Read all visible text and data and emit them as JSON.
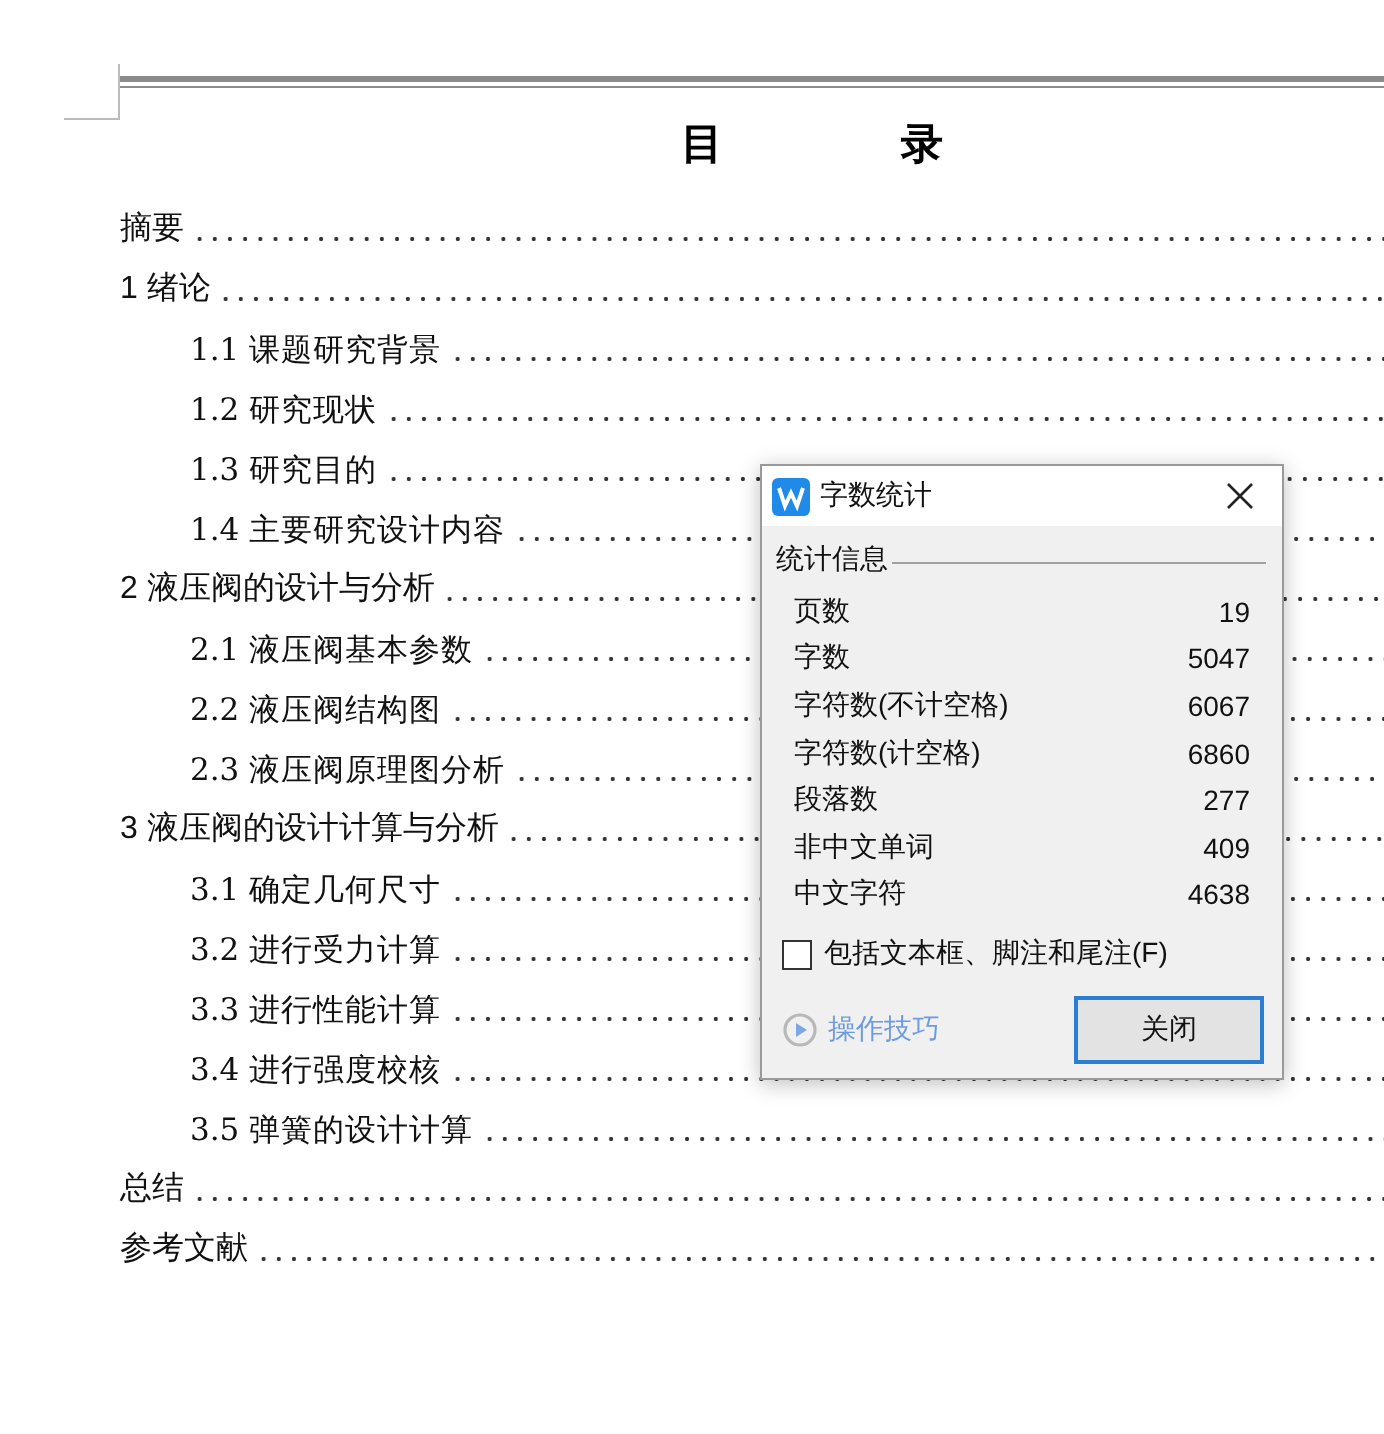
{
  "document": {
    "title": "目 录",
    "toc": [
      {
        "label": "摘要"
      },
      {
        "label": "1 绪论",
        "children": [
          {
            "label": "1.1 课题研究背景"
          },
          {
            "label": "1.2 研究现状"
          },
          {
            "label": "1.3 研究目的"
          },
          {
            "label": "1.4 主要研究设计内容"
          }
        ]
      },
      {
        "label": "2 液压阀的设计与分析",
        "children": [
          {
            "label": "2.1 液压阀基本参数"
          },
          {
            "label": "2.2 液压阀结构图"
          },
          {
            "label": "2.3 液压阀原理图分析"
          }
        ]
      },
      {
        "label": "3 液压阀的设计计算与分析",
        "children": [
          {
            "label": "3.1 确定几何尺寸"
          },
          {
            "label": "3.2 进行受力计算"
          },
          {
            "label": "3.3 进行性能计算"
          },
          {
            "label": "3.4 进行强度校核"
          },
          {
            "label": "3.5 弹簧的设计计算"
          }
        ]
      },
      {
        "label": "总结"
      },
      {
        "label": "参考文献"
      }
    ]
  },
  "dialog": {
    "title": "字数统计",
    "section": "统计信息",
    "stats": [
      {
        "label": "页数",
        "value": "19"
      },
      {
        "label": "字数",
        "value": "5047"
      },
      {
        "label": "字符数(不计空格)",
        "value": "6067"
      },
      {
        "label": "字符数(计空格)",
        "value": "6860"
      },
      {
        "label": "段落数",
        "value": "277"
      },
      {
        "label": "非中文单词",
        "value": "409"
      },
      {
        "label": "中文字符",
        "value": "4638"
      }
    ],
    "checkbox": {
      "label": "包括文本框、脚注和尾注(F)",
      "checked": false
    },
    "tips_link": "操作技巧",
    "close_button": "关闭"
  }
}
